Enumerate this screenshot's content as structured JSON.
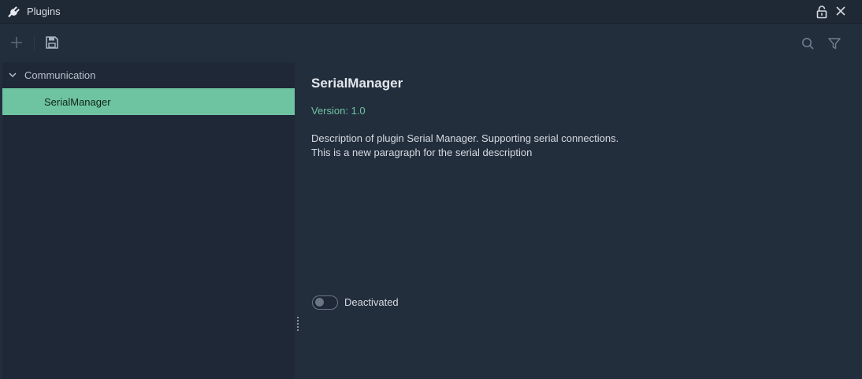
{
  "window": {
    "title": "Plugins"
  },
  "toolbar": {
    "add_icon": "plus-icon",
    "save_icon": "save-icon",
    "search_icon": "search-icon",
    "filter_icon": "filter-icon"
  },
  "sidebar": {
    "groups": [
      {
        "label": "Communication",
        "expanded": true,
        "items": [
          {
            "label": "SerialManager",
            "selected": true
          }
        ]
      }
    ]
  },
  "details": {
    "name": "SerialManager",
    "version": "Version: 1.0",
    "description_lines": [
      "Description of plugin Serial Manager. Supporting serial connections.",
      "This is a new paragraph for the serial description"
    ],
    "toggle_label": "Deactivated",
    "toggle_on": false
  },
  "colors": {
    "background": "#232e3d",
    "sidebar": "#1f2836",
    "accent": "#6ec4a0",
    "text": "#d6dbe1"
  }
}
